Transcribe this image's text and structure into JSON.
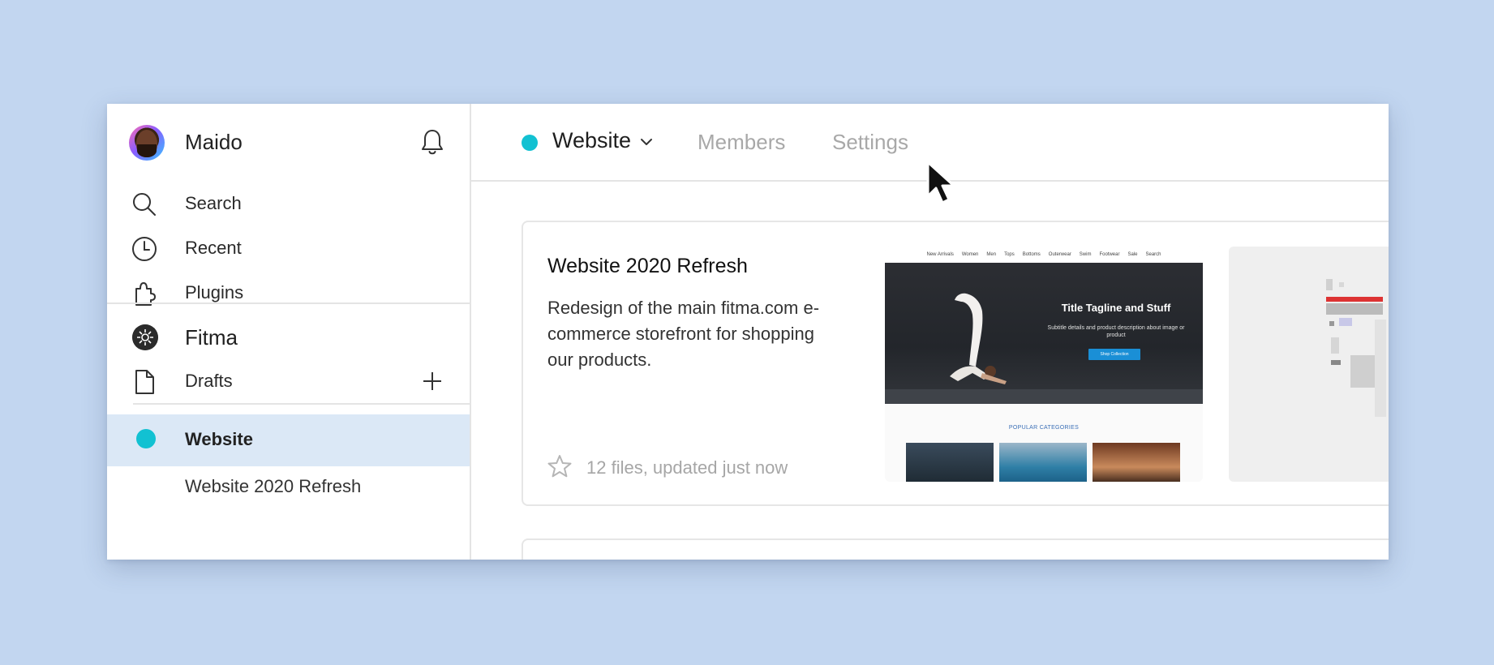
{
  "user": {
    "name": "Maido"
  },
  "nav": [
    {
      "id": "search",
      "label": "Search",
      "icon": "search-icon"
    },
    {
      "id": "recent",
      "label": "Recent",
      "icon": "clock-icon"
    },
    {
      "id": "plugins",
      "label": "Plugins",
      "icon": "puzzle-icon"
    }
  ],
  "org": {
    "name": "Fitma",
    "drafts_label": "Drafts"
  },
  "projects": {
    "active": {
      "label": "Website",
      "color": "#12c1d2"
    },
    "sub_item": "Website 2020 Refresh"
  },
  "topbar": {
    "project": "Website",
    "tabs": [
      "Members",
      "Settings"
    ]
  },
  "card": {
    "title": "Website 2020 Refresh",
    "description": "Redesign of the main fitma.com e-commerce storefront for shopping our products.",
    "meta": "12 files, updated just now",
    "thumb": {
      "nav": [
        "New Arrivals",
        "Women",
        "Men",
        "Tops",
        "Bottoms",
        "Outerwear",
        "Swim",
        "Footwear",
        "Sale",
        "Search"
      ],
      "hero_title": "Title Tagline and Stuff",
      "hero_sub": "Subtitle details and product description about image or product",
      "cta": "Shop Collection",
      "section": "POPULAR CATEGORIES"
    }
  },
  "colors": {
    "accent": "#12c1d2",
    "active_bg": "#dbe8f6",
    "background": "#c2d6f0"
  }
}
